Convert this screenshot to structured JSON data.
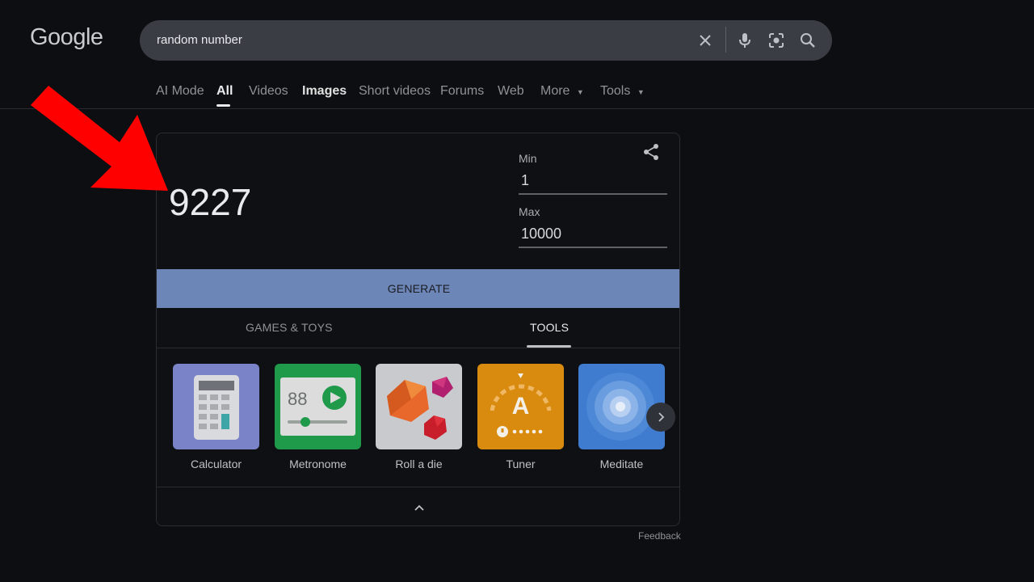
{
  "header": {
    "logo": "Google",
    "search": {
      "value": "random number"
    }
  },
  "tabs": [
    {
      "label": "AI Mode"
    },
    {
      "label": "All"
    },
    {
      "label": "Videos"
    },
    {
      "label": "Images"
    },
    {
      "label": "Short videos"
    },
    {
      "label": "Forums"
    },
    {
      "label": "Web"
    },
    {
      "label": "More"
    },
    {
      "label": "Tools"
    }
  ],
  "rng": {
    "result": "9227",
    "min_label": "Min",
    "min_value": "1",
    "max_label": "Max",
    "max_value": "10000",
    "generate_label": "GENERATE"
  },
  "categories": {
    "games": "GAMES & TOYS",
    "tools": "TOOLS"
  },
  "tools": [
    {
      "label": "Calculator",
      "icon": "calculator-icon"
    },
    {
      "label": "Metronome",
      "icon": "metronome-icon",
      "display": "88"
    },
    {
      "label": "Roll a die",
      "icon": "dice-icon"
    },
    {
      "label": "Tuner",
      "icon": "tuner-icon",
      "note": "A"
    },
    {
      "label": "Meditate",
      "icon": "meditate-icon"
    }
  ],
  "feedback": "Feedback",
  "colors": {
    "background": "#0d0e11",
    "generate": "#6d86b8",
    "annotation_arrow": "#ff0000"
  }
}
